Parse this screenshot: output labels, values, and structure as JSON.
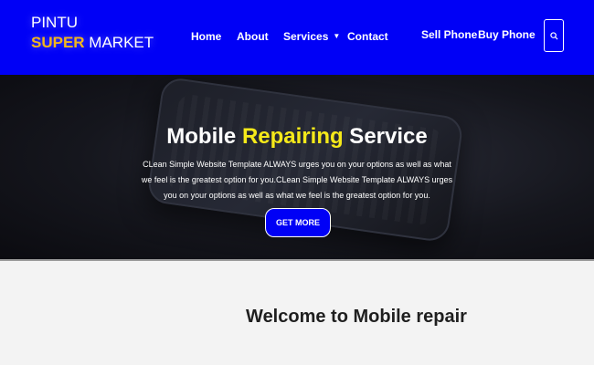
{
  "logo": {
    "line1": "PINTU",
    "line2_accent": "SUPER",
    "line2_rest": " MARKET"
  },
  "nav": {
    "home": "Home",
    "about": "About",
    "services": "Services",
    "contact": "Contact",
    "sell_phone": "Sell Phone",
    "buy_phone": "Buy Phone"
  },
  "icons": {
    "search": "search-icon",
    "caret": "caret-down-icon"
  },
  "hero": {
    "title_pre": "Mobile ",
    "title_accent": "Repairing",
    "title_post": " Service",
    "text": "CLean Simple Website Template ALWAYS urges you on your options as well as what we feel is the greatest option for you.CLean Simple Website Template ALWAYS urges you on your options as well as what we feel is the greatest option for you.",
    "button": "GET MORE"
  },
  "section": {
    "welcome": "Welcome to Mobile repair"
  },
  "colors": {
    "brand": "#0000f6",
    "accent": "#f2b51c",
    "hero_accent": "#f5e91a"
  }
}
